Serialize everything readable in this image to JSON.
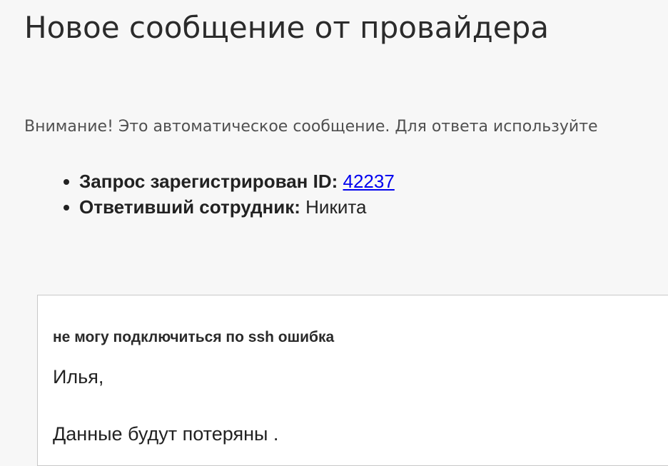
{
  "page": {
    "title": "Новое сообщение от провайдера",
    "notice": "Внимание! Это автоматическое сообщение. Для ответа используйте"
  },
  "details": {
    "request_label": "Запрос зарегистрирован ID:",
    "request_id": "42237",
    "employee_label": "Ответивший сотрудник:",
    "employee_name": "Никита"
  },
  "message": {
    "subject": "не могу подключиться по ssh ошибка",
    "greeting": "Илья,",
    "body": "Данные будут потеряны ."
  },
  "colors": {
    "background": "#f7f7f7",
    "link": "#0000ee",
    "card": "#ffffff",
    "card_border": "#c8c8c8"
  }
}
